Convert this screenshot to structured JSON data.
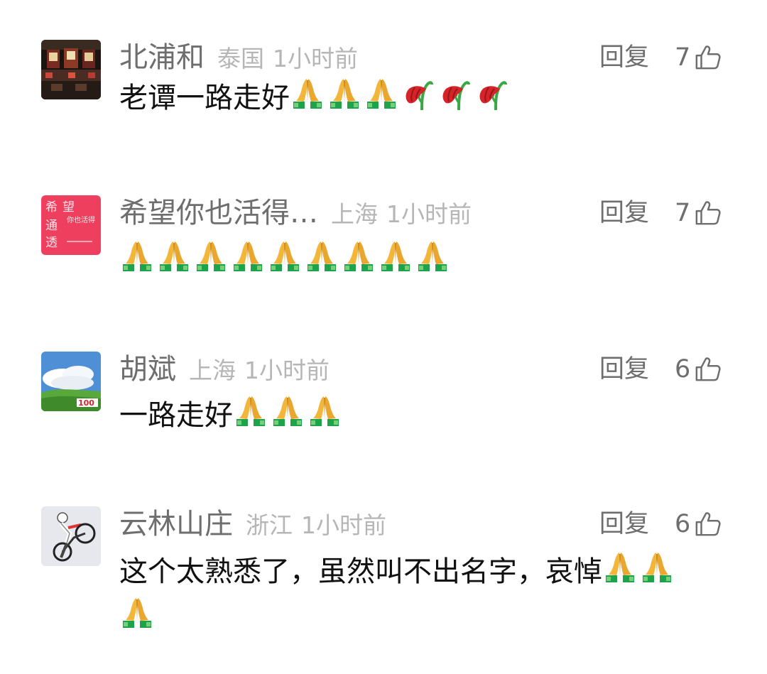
{
  "comments": [
    {
      "username": "北浦和",
      "location": "泰国",
      "time": "1小时前",
      "reply_label": "回复",
      "likes": "7",
      "text_before": "老谭一路走好",
      "emojis_before": [
        "pray",
        "pray",
        "pray",
        "wilted-flower",
        "wilted-flower",
        "wilted-flower"
      ],
      "text_after": "",
      "line2_emojis": []
    },
    {
      "username": "希望你也活得…",
      "location": "上海",
      "time": "1小时前",
      "reply_label": "回复",
      "likes": "7",
      "text_before": "",
      "emojis_before": [
        "pray",
        "pray",
        "pray",
        "pray",
        "pray",
        "pray",
        "pray",
        "pray",
        "pray"
      ],
      "text_after": "",
      "line2_emojis": [],
      "avatar_text": [
        "希",
        "望",
        "通",
        "透",
        "你也活得"
      ]
    },
    {
      "username": "胡斌",
      "location": "上海",
      "time": "1小时前",
      "reply_label": "回复",
      "likes": "6",
      "text_before": "一路走好",
      "emojis_before": [
        "pray",
        "pray",
        "pray"
      ],
      "text_after": "",
      "line2_emojis": [],
      "avatar_text": [
        "100"
      ]
    },
    {
      "username": "云林山庄",
      "location": "浙江",
      "time": "1小时前",
      "reply_label": "回复",
      "likes": "6",
      "text_before": "这个太熟悉了，虽然叫不出名字，哀悼",
      "emojis_before": [
        "pray",
        "pray"
      ],
      "text_after": "",
      "line2_emojis": [
        "pray"
      ]
    }
  ],
  "icons": {
    "like": "thumbs-up-outline-icon",
    "pray": "folded-hands-emoji",
    "wilted": "wilted-flower-emoji"
  },
  "colors": {
    "name": "#6e6e6e",
    "meta": "#b6b6b6",
    "text": "#111111",
    "background": "#ffffff"
  }
}
